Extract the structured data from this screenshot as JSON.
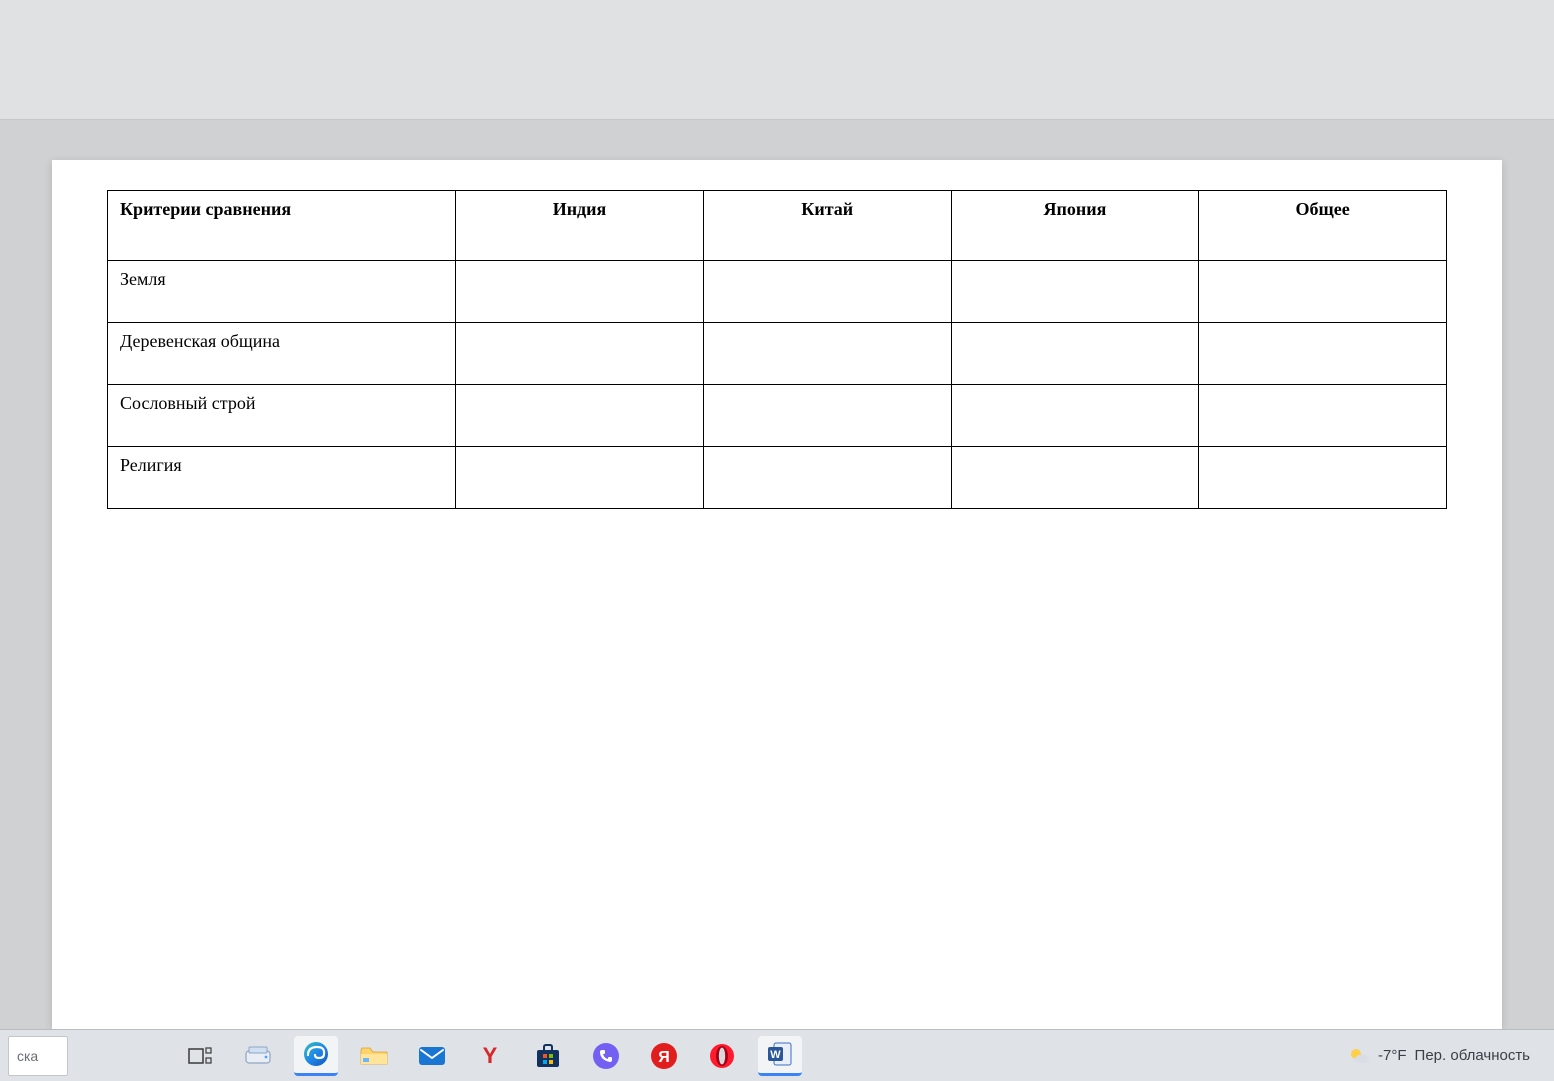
{
  "document": {
    "table": {
      "headers": [
        "Критерии сравнения",
        "Индия",
        "Китай",
        "Япония",
        "Общее"
      ],
      "rows": [
        {
          "label": "Земля",
          "cells": [
            "",
            "",
            "",
            ""
          ]
        },
        {
          "label": "Деревенская община",
          "cells": [
            "",
            "",
            "",
            ""
          ]
        },
        {
          "label": "Сословный строй",
          "cells": [
            "",
            "",
            "",
            ""
          ]
        },
        {
          "label": "Религия",
          "cells": [
            "",
            "",
            "",
            ""
          ]
        }
      ]
    }
  },
  "taskbar": {
    "search_fragment": "ска",
    "apps": [
      {
        "id": "task-view",
        "icon": "taskview"
      },
      {
        "id": "scanner",
        "icon": "scanner"
      },
      {
        "id": "edge",
        "icon": "edge",
        "active": true
      },
      {
        "id": "file-explorer",
        "icon": "explorer"
      },
      {
        "id": "mail",
        "icon": "mail"
      },
      {
        "id": "yandex",
        "icon": "yandex"
      },
      {
        "id": "ms-store",
        "icon": "store"
      },
      {
        "id": "viber",
        "icon": "viber"
      },
      {
        "id": "yandex-red",
        "icon": "yandex-red"
      },
      {
        "id": "opera",
        "icon": "opera"
      },
      {
        "id": "word",
        "icon": "word",
        "active": true
      }
    ],
    "weather": {
      "temperature": "-7°F",
      "condition": "Пер. облачность"
    }
  }
}
